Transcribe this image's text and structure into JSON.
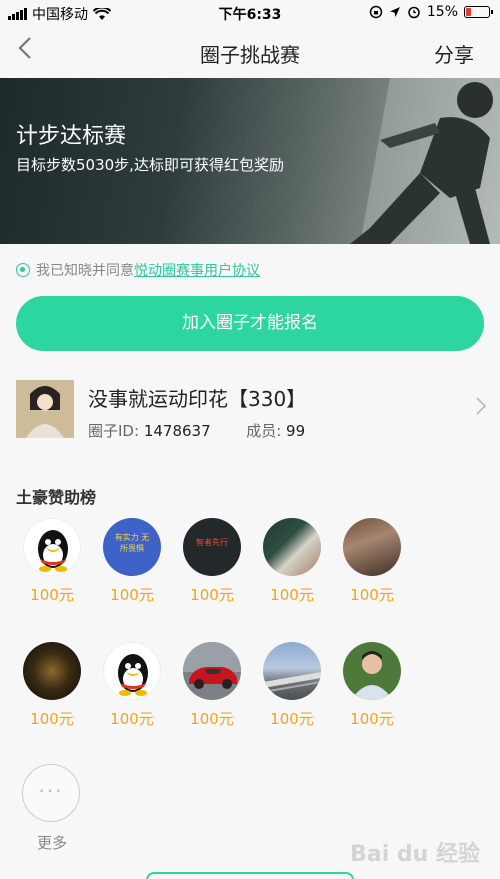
{
  "status": {
    "carrier": "中国移动",
    "time": "下午6:33",
    "battery": "15%"
  },
  "nav": {
    "back_icon": "chevron-left-icon",
    "title": "圈子挑战赛",
    "share": "分享"
  },
  "banner": {
    "title": "计步达标赛",
    "subtitle": "目标步数5030步,达标即可获得红包奖励"
  },
  "agreement": {
    "prefix": "我已知晓并同意",
    "link": "悦动圈赛事用户协议"
  },
  "join_button": "加入圈子才能报名",
  "circle": {
    "name": "没事就运动印花【330】",
    "id_label": "圈子ID:",
    "id_value": "1478637",
    "members_label": "成员:",
    "members_value": "99"
  },
  "sponsors": {
    "title": "土豪赞助榜",
    "items": [
      {
        "amount": "100元",
        "avatar": "qq-penguin"
      },
      {
        "amount": "100元",
        "avatar": "blue-text-art",
        "art_text": "有实力 无所畏惧"
      },
      {
        "amount": "100元",
        "avatar": "dark-text-art",
        "art_text": "智者先行"
      },
      {
        "amount": "100元",
        "avatar": "photo-hand"
      },
      {
        "amount": "100元",
        "avatar": "photo-room"
      },
      {
        "amount": "100元",
        "avatar": "dark-photo"
      },
      {
        "amount": "100元",
        "avatar": "qq-penguin"
      },
      {
        "amount": "100元",
        "avatar": "red-car"
      },
      {
        "amount": "100元",
        "avatar": "highway"
      },
      {
        "amount": "100元",
        "avatar": "man-portrait"
      }
    ],
    "more_label": "更多"
  },
  "watermark": "Bai du 经验",
  "colors": {
    "accent": "#2dd5a0",
    "amount": "#f2a324",
    "link": "#2fc79c"
  }
}
